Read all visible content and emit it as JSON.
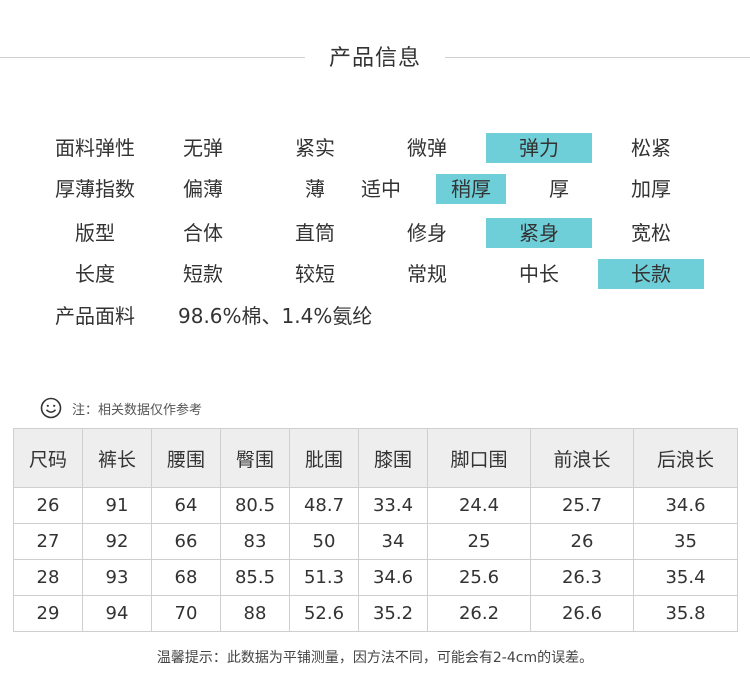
{
  "title": "产品信息",
  "attributes": [
    {
      "label": "面料弹性",
      "options": [
        "无弹",
        "紧实",
        "微弹",
        "弹力",
        "松紧"
      ],
      "selected": 3
    },
    {
      "label": "厚薄指数",
      "options": [
        "偏薄",
        "薄",
        "适中",
        "稍厚",
        "厚",
        "加厚"
      ],
      "selected": 3
    },
    {
      "label": "版型",
      "options": [
        "合体",
        "直筒",
        "修身",
        "紧身",
        "宽松"
      ],
      "selected": 3
    },
    {
      "label": "长度",
      "options": [
        "短款",
        "较短",
        "常规",
        "中长",
        "长款"
      ],
      "selected": 4
    }
  ],
  "fabric": {
    "label": "产品面料",
    "value": "98.6%棉、1.4%氨纶"
  },
  "note": "注：相关数据仅作参考",
  "table": {
    "headers": [
      "尺码",
      "裤长",
      "腰围",
      "臀围",
      "肶围",
      "膝围",
      "脚口围",
      "前浪长",
      "后浪长"
    ],
    "rows": [
      [
        "26",
        "91",
        "64",
        "80.5",
        "48.7",
        "33.4",
        "24.4",
        "25.7",
        "34.6"
      ],
      [
        "27",
        "92",
        "66",
        "83",
        "50",
        "34",
        "25",
        "26",
        "35"
      ],
      [
        "28",
        "93",
        "68",
        "85.5",
        "51.3",
        "34.6",
        "25.6",
        "26.3",
        "35.4"
      ],
      [
        "29",
        "94",
        "70",
        "88",
        "52.6",
        "35.2",
        "26.2",
        "26.6",
        "35.8"
      ]
    ]
  },
  "footer": "温馨提示：此数据为平铺测量，因方法不同，可能会有2-4cm的误差。",
  "colors": {
    "highlight": "#6fcfd9",
    "header_bg": "#eeeeee",
    "border": "#cfcfcf"
  }
}
